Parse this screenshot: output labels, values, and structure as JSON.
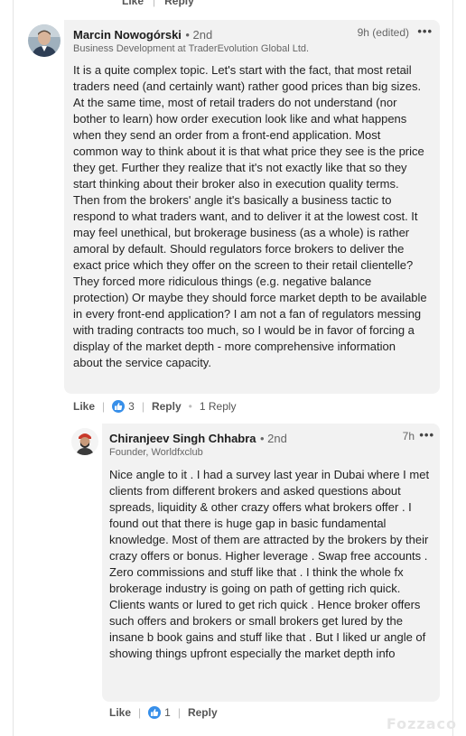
{
  "top_bar": {
    "like_label": "Like",
    "reply_label": "Reply"
  },
  "comment1": {
    "author": "Marcin Nowogórski",
    "degree": "• 2nd",
    "headline": "Business Development at TraderEvolution Global Ltd.",
    "time": "9h (edited)",
    "more": "•••",
    "body": [
      "It is a quite complex topic. Let's start with the fact, that most retail traders need (and certainly want) rather good prices than big sizes. At the same time, most of retail traders do not understand (nor bother to learn) how order execution look like and what happens when they send an order from a front-end application. Most common way to think about it is that what price they see is the price they get. Further they realize that it's not exactly like that so they start thinking about their broker also in execution quality terms.",
      "Then from the brokers' angle it's basically a business tactic to respond to what traders want, and to deliver it at the lowest cost. It may feel unethical, but brokerage business (as a whole) is rather amoral by default. Should regulators force brokers to deliver the exact price which they offer on the screen to their retail clientelle? They forced more ridiculous things (e.g. negative balance protection) Or maybe they should force market depth to be available in every front-end application? I am not a fan of regulators messing with trading contracts too much, so I would be in favor of forcing a display of the market depth - more comprehensive information about the service capacity."
    ],
    "like_label": "Like",
    "reaction_count": "3",
    "reply_label": "Reply",
    "replies_count": "1 Reply"
  },
  "comment2": {
    "author": "Chiranjeev Singh Chhabra",
    "degree": "• 2nd",
    "headline": "Founder, Worldfxclub",
    "time": "7h",
    "more": "•••",
    "body": [
      "Nice angle to it . I had a survey last year in Dubai where I met clients from different brokers and asked questions about spreads, liquidity & other crazy offers what brokers offer . I found out that there is huge gap in basic fundamental knowledge. Most of them are attracted by the brokers by their crazy offers or bonus. Higher leverage . Swap free accounts . Zero commissions and stuff like that . I think the whole fx brokerage industry is going on path of getting rich quick.",
      "Clients wants or lured to get rich quick . Hence broker offers such offers and brokers or small brokers get lured by the insane b book gains and stuff like that . But I liked ur angle of showing things upfront especially the market depth info"
    ],
    "like_label": "Like",
    "reaction_count": "1",
    "reply_label": "Reply"
  },
  "watermark": "Fozzaco",
  "colors": {
    "bubble": "#f2f2f2",
    "like_blue": "#378fe9"
  }
}
